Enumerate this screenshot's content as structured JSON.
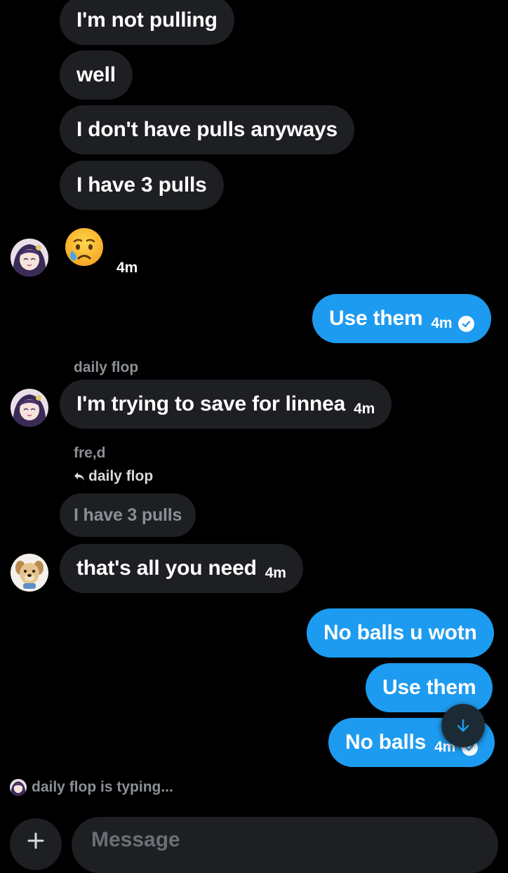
{
  "messages": {
    "m1": {
      "text": "I'm not pulling"
    },
    "m2": {
      "text": "well"
    },
    "m3": {
      "text": "I don't have pulls anyways"
    },
    "m4": {
      "text": "I have 3 pulls"
    },
    "m5": {
      "emoji": "😢",
      "time": "4m"
    },
    "m6": {
      "text": "Use them",
      "time": "4m"
    },
    "m7": {
      "sender": "daily flop",
      "text": "I'm trying to save for linnea",
      "time": "4m"
    },
    "m8": {
      "sender": "fre,d",
      "reply_to": "daily flop",
      "quoted_text": "I have 3 pulls",
      "text": "that's all you need",
      "time": "4m"
    },
    "m9": {
      "text": "No balls u wotn"
    },
    "m10": {
      "text": "Use them"
    },
    "m11": {
      "text": "No balls",
      "time": "4m"
    }
  },
  "typing_indicator": {
    "text": "daily flop is typing..."
  },
  "composer": {
    "placeholder": "Message"
  },
  "colors": {
    "background": "#000000",
    "incoming_bubble": "#1d1f23",
    "outgoing_bubble": "#1d9bf0",
    "muted_text": "#8b8f95"
  },
  "icons": {
    "read_receipt": "check-circle-icon",
    "reply": "reply-arrow-icon",
    "scroll_down": "arrow-down-icon",
    "add": "plus-icon"
  }
}
